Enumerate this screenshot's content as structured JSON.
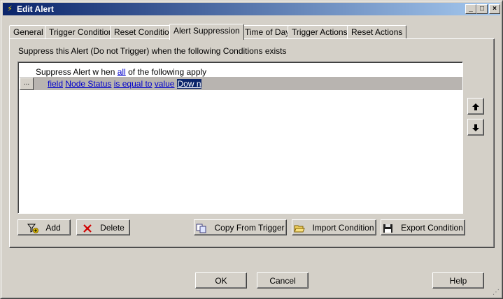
{
  "window": {
    "title": "Edit Alert"
  },
  "tabs": [
    {
      "label": "General"
    },
    {
      "label": "Trigger Condition"
    },
    {
      "label": "Reset Condition"
    },
    {
      "label": "Alert Suppression"
    },
    {
      "label": "Time of Day"
    },
    {
      "label": "Trigger Actions"
    },
    {
      "label": "Reset Actions"
    }
  ],
  "active_tab": "Alert Suppression",
  "panel": {
    "caption": "Suppress this Alert (Do not Trigger) when the following Conditions exists",
    "condition_header": {
      "prefix": "Suppress Alert w hen",
      "quantifier": "all",
      "suffix": "of the following apply"
    },
    "condition_row": {
      "handle": "...",
      "field_kw": "field",
      "field": "Node Status",
      "operator": "is equal to",
      "value_kw": "value",
      "value": "Dow n"
    },
    "buttons": {
      "add": "Add",
      "delete": "Delete",
      "copy_from_trigger": "Copy From Trigger",
      "import_condition": "Import Condition",
      "export_condition": "Export Condition"
    }
  },
  "dialog_buttons": {
    "ok": "OK",
    "cancel": "Cancel",
    "help": "Help"
  },
  "colors": {
    "titlebar": "#0a246a",
    "link": "#0000cc",
    "selection": "#0a246a"
  }
}
